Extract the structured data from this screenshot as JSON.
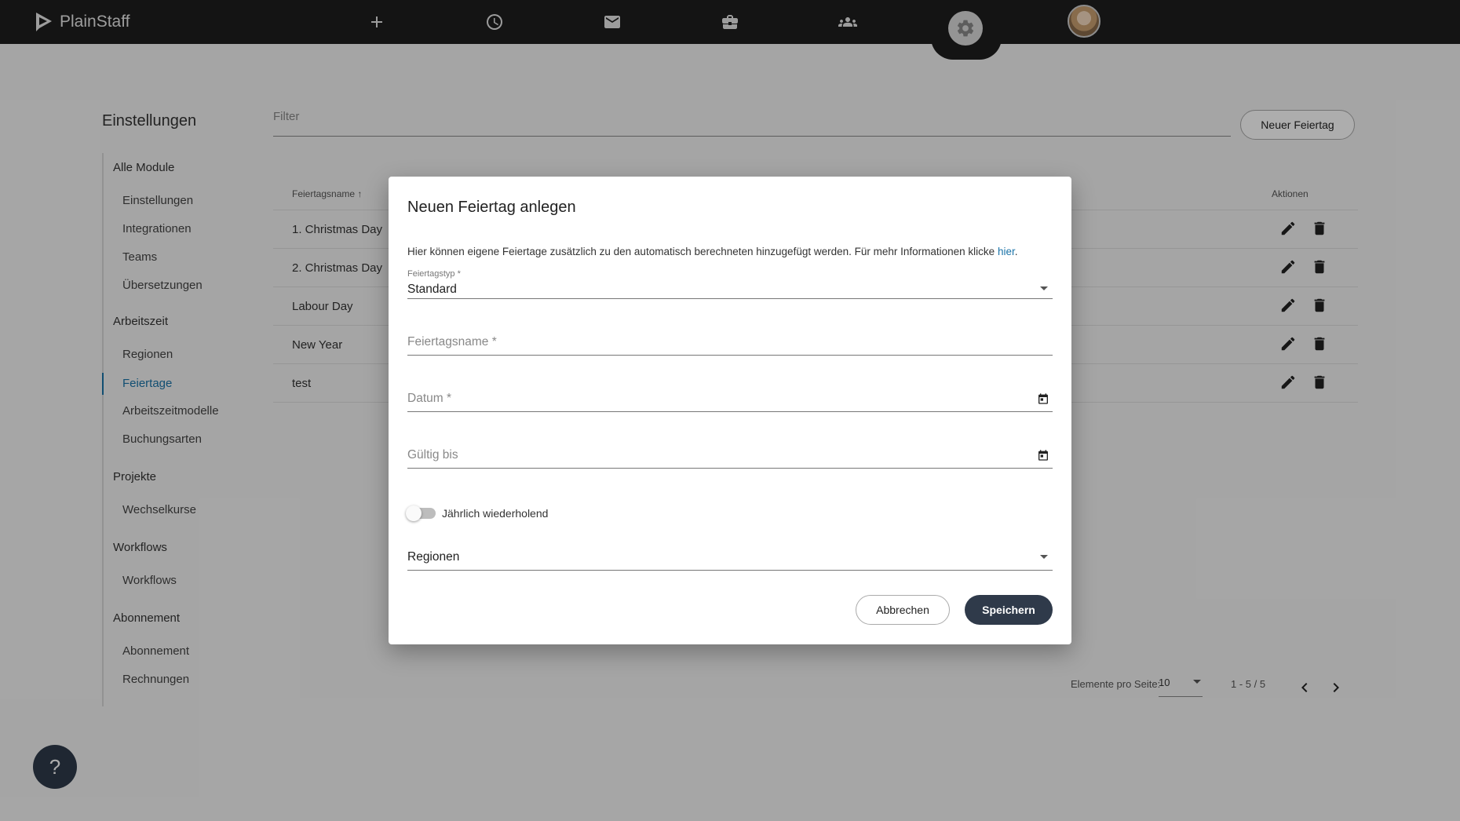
{
  "app": {
    "name": "PlainStaff"
  },
  "nav": {
    "items": [
      {
        "icon": "plus-icon"
      },
      {
        "icon": "clock-icon"
      },
      {
        "icon": "mail-icon"
      },
      {
        "icon": "briefcase-icon"
      },
      {
        "icon": "people-icon"
      },
      {
        "icon": "gear-icon",
        "active": true
      },
      {
        "icon": "avatar"
      }
    ]
  },
  "page": {
    "title": "Einstellungen",
    "filter_placeholder": "Filter",
    "new_button": "Neuer Feiertag"
  },
  "sidebar": {
    "groups": [
      {
        "label": "Alle Module",
        "items": [
          "Einstellungen",
          "Integrationen",
          "Teams",
          "Übersetzungen"
        ]
      },
      {
        "label": "Arbeitszeit",
        "items": [
          "Regionen",
          "Feiertage",
          "Arbeitszeitmodelle",
          "Buchungsarten"
        ]
      },
      {
        "label": "Projekte",
        "items": [
          "Wechselkurse"
        ]
      },
      {
        "label": "Workflows",
        "items": [
          "Workflows"
        ]
      },
      {
        "label": "Abonnement",
        "items": [
          "Abonnement",
          "Rechnungen"
        ]
      }
    ],
    "active_item": "Feiertage"
  },
  "table": {
    "columns": [
      "Feiertagsname",
      "Aktionen"
    ],
    "sort_icon": "arrow-up-icon",
    "rows": [
      "1. Christmas Day",
      "2. Christmas Day",
      "Labour Day",
      "New Year",
      "test"
    ]
  },
  "pagination": {
    "label": "Elemente pro Seite:",
    "page_size": "10",
    "range": "1 - 5 / 5"
  },
  "help": {
    "label": "?"
  },
  "dialog": {
    "title": "Neuen Feiertag anlegen",
    "info_text": "Hier können eigene Feiertage zusätzlich zu den automatisch berechneten hinzugefügt werden. Für mehr Informationen klicke ",
    "info_link": "hier",
    "info_end": ".",
    "type_label": "Feiertagstyp *",
    "type_value": "Standard",
    "name_placeholder": "Feiertagsname *",
    "date_placeholder": "Datum *",
    "valid_until_placeholder": "Gültig bis",
    "recurring_label": "Jährlich wiederholend",
    "recurring_on": false,
    "regions_placeholder": "Regionen",
    "cancel": "Abbrechen",
    "save": "Speichern"
  },
  "colors": {
    "topbar": "#1e1e1e",
    "accent": "#1a73a8",
    "primary_button": "#2f3a4a"
  }
}
